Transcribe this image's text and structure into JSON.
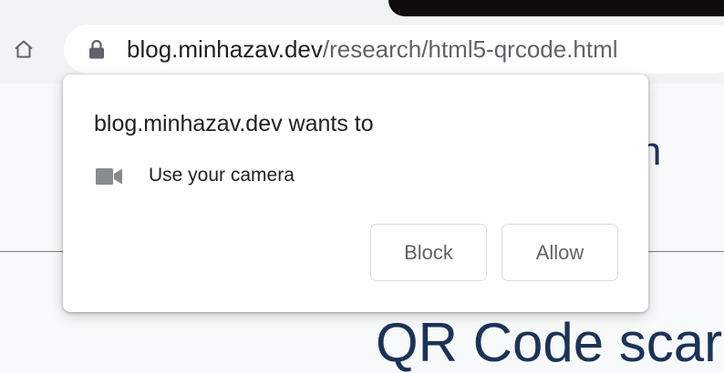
{
  "browser": {
    "url_domain": "blog.minhazav.dev",
    "url_path": "/research/html5-qrcode.html",
    "home_icon": "home-icon",
    "lock_icon": "lock-icon"
  },
  "page": {
    "heading_partial": "erin",
    "heading_main": "QR Code scar"
  },
  "permission_prompt": {
    "title": "blog.minhazav.dev wants to",
    "permission_icon": "camera-icon",
    "permission_label": "Use your camera",
    "block_label": "Block",
    "allow_label": "Allow"
  },
  "colors": {
    "toolbar": "#f1f3f4",
    "heading": "#1c3357",
    "url_domain": "#202124",
    "url_path": "#5f6368"
  }
}
